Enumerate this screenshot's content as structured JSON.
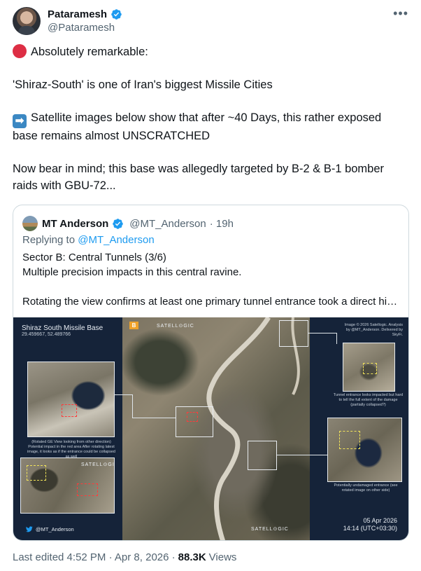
{
  "author": {
    "name": "Pataramesh",
    "handle": "@Pataramesh"
  },
  "more_label": "•••",
  "tweet": {
    "line1": "Absolutely remarkable:",
    "line2": "'Shiraz-South' is one of Iran's biggest Missile Cities",
    "line3": "Satellite images below show that after ~40 Days, this rather exposed base remains almost UNSCRATCHED",
    "line4": "Now bear in mind; this base was allegedly targeted by B-2 & B-1 bomber raids with GBU-72..."
  },
  "emoji": {
    "red_circle": "red-circle-emoji",
    "right_arrow": "➡"
  },
  "quote": {
    "name": "MT Anderson",
    "handle": "@MT_Anderson",
    "time": "· 19h",
    "replying_prefix": "Replying to",
    "replying_to": "@MT_Anderson",
    "text_line1": "Sector B: Central Tunnels (3/6)",
    "text_line2": "Multiple precision impacts in this central ravine.",
    "text_line3": "Rotating the view confirms at least one primary tunnel entrance took a direct hi…"
  },
  "image": {
    "title": "Shiraz South Missile Base",
    "coords": "29.459667, 52.489766",
    "badge": "B",
    "brand": "SATELL⊙GIC",
    "credit": "Image © 2026 Satellogic. Analysis by @MT_Anderson. Delivered by SkyFi.",
    "caption_left": "(Rotated GE View looking from other direction) Potential impact in the red area After rotating latest image, it looks as if the entrance could be collapsed as well",
    "caption_right_top": "Tunnel entrance looks impacted but hard to tell the full extent of the damage (partially collapsed?)",
    "caption_right_bottom": "Potentially undamaged entrance (see rotated image on other side)",
    "handle": "@MT_Anderson",
    "date": "05 Apr 2026",
    "time": "14:14 (UTC+03:30)"
  },
  "footer": {
    "edited": "Last edited 4:52 PM · Apr 8, 2026 ·",
    "views_count": "88.3K",
    "views_label": "Views"
  },
  "colors": {
    "verified": "#1d9bf0",
    "text_primary": "#0f1419",
    "text_secondary": "#536471",
    "link": "#1d9bf0",
    "border": "#cfd9de"
  }
}
